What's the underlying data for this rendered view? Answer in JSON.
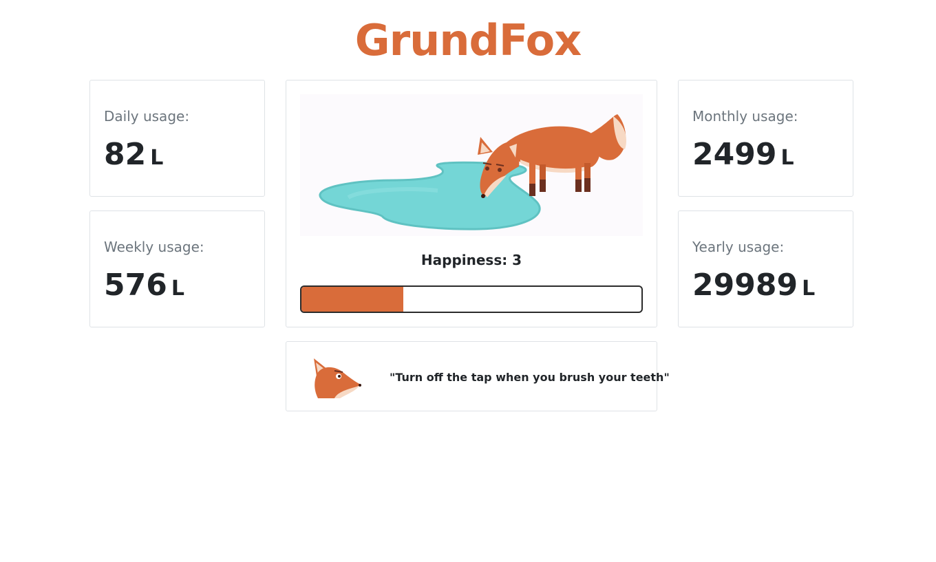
{
  "app": {
    "title": "GrundFox"
  },
  "stats": {
    "daily": {
      "label": "Daily usage:",
      "value": "82",
      "unit": "L"
    },
    "weekly": {
      "label": "Weekly usage:",
      "value": "576",
      "unit": "L"
    },
    "monthly": {
      "label": "Monthly usage:",
      "value": "2499",
      "unit": "L"
    },
    "yearly": {
      "label": "Yearly usage:",
      "value": "29989",
      "unit": "L"
    }
  },
  "happiness": {
    "label": "Happiness: 3",
    "level_fraction": 0.3
  },
  "tip": {
    "text": "\"Turn off the tap when you brush your teeth\""
  },
  "colors": {
    "brand": "#d96c3a",
    "water": "#74d6d6",
    "border": "#dee2e6"
  },
  "icons": {
    "scene": "fox-drinking-illustration",
    "tip": "fox-head-icon"
  }
}
